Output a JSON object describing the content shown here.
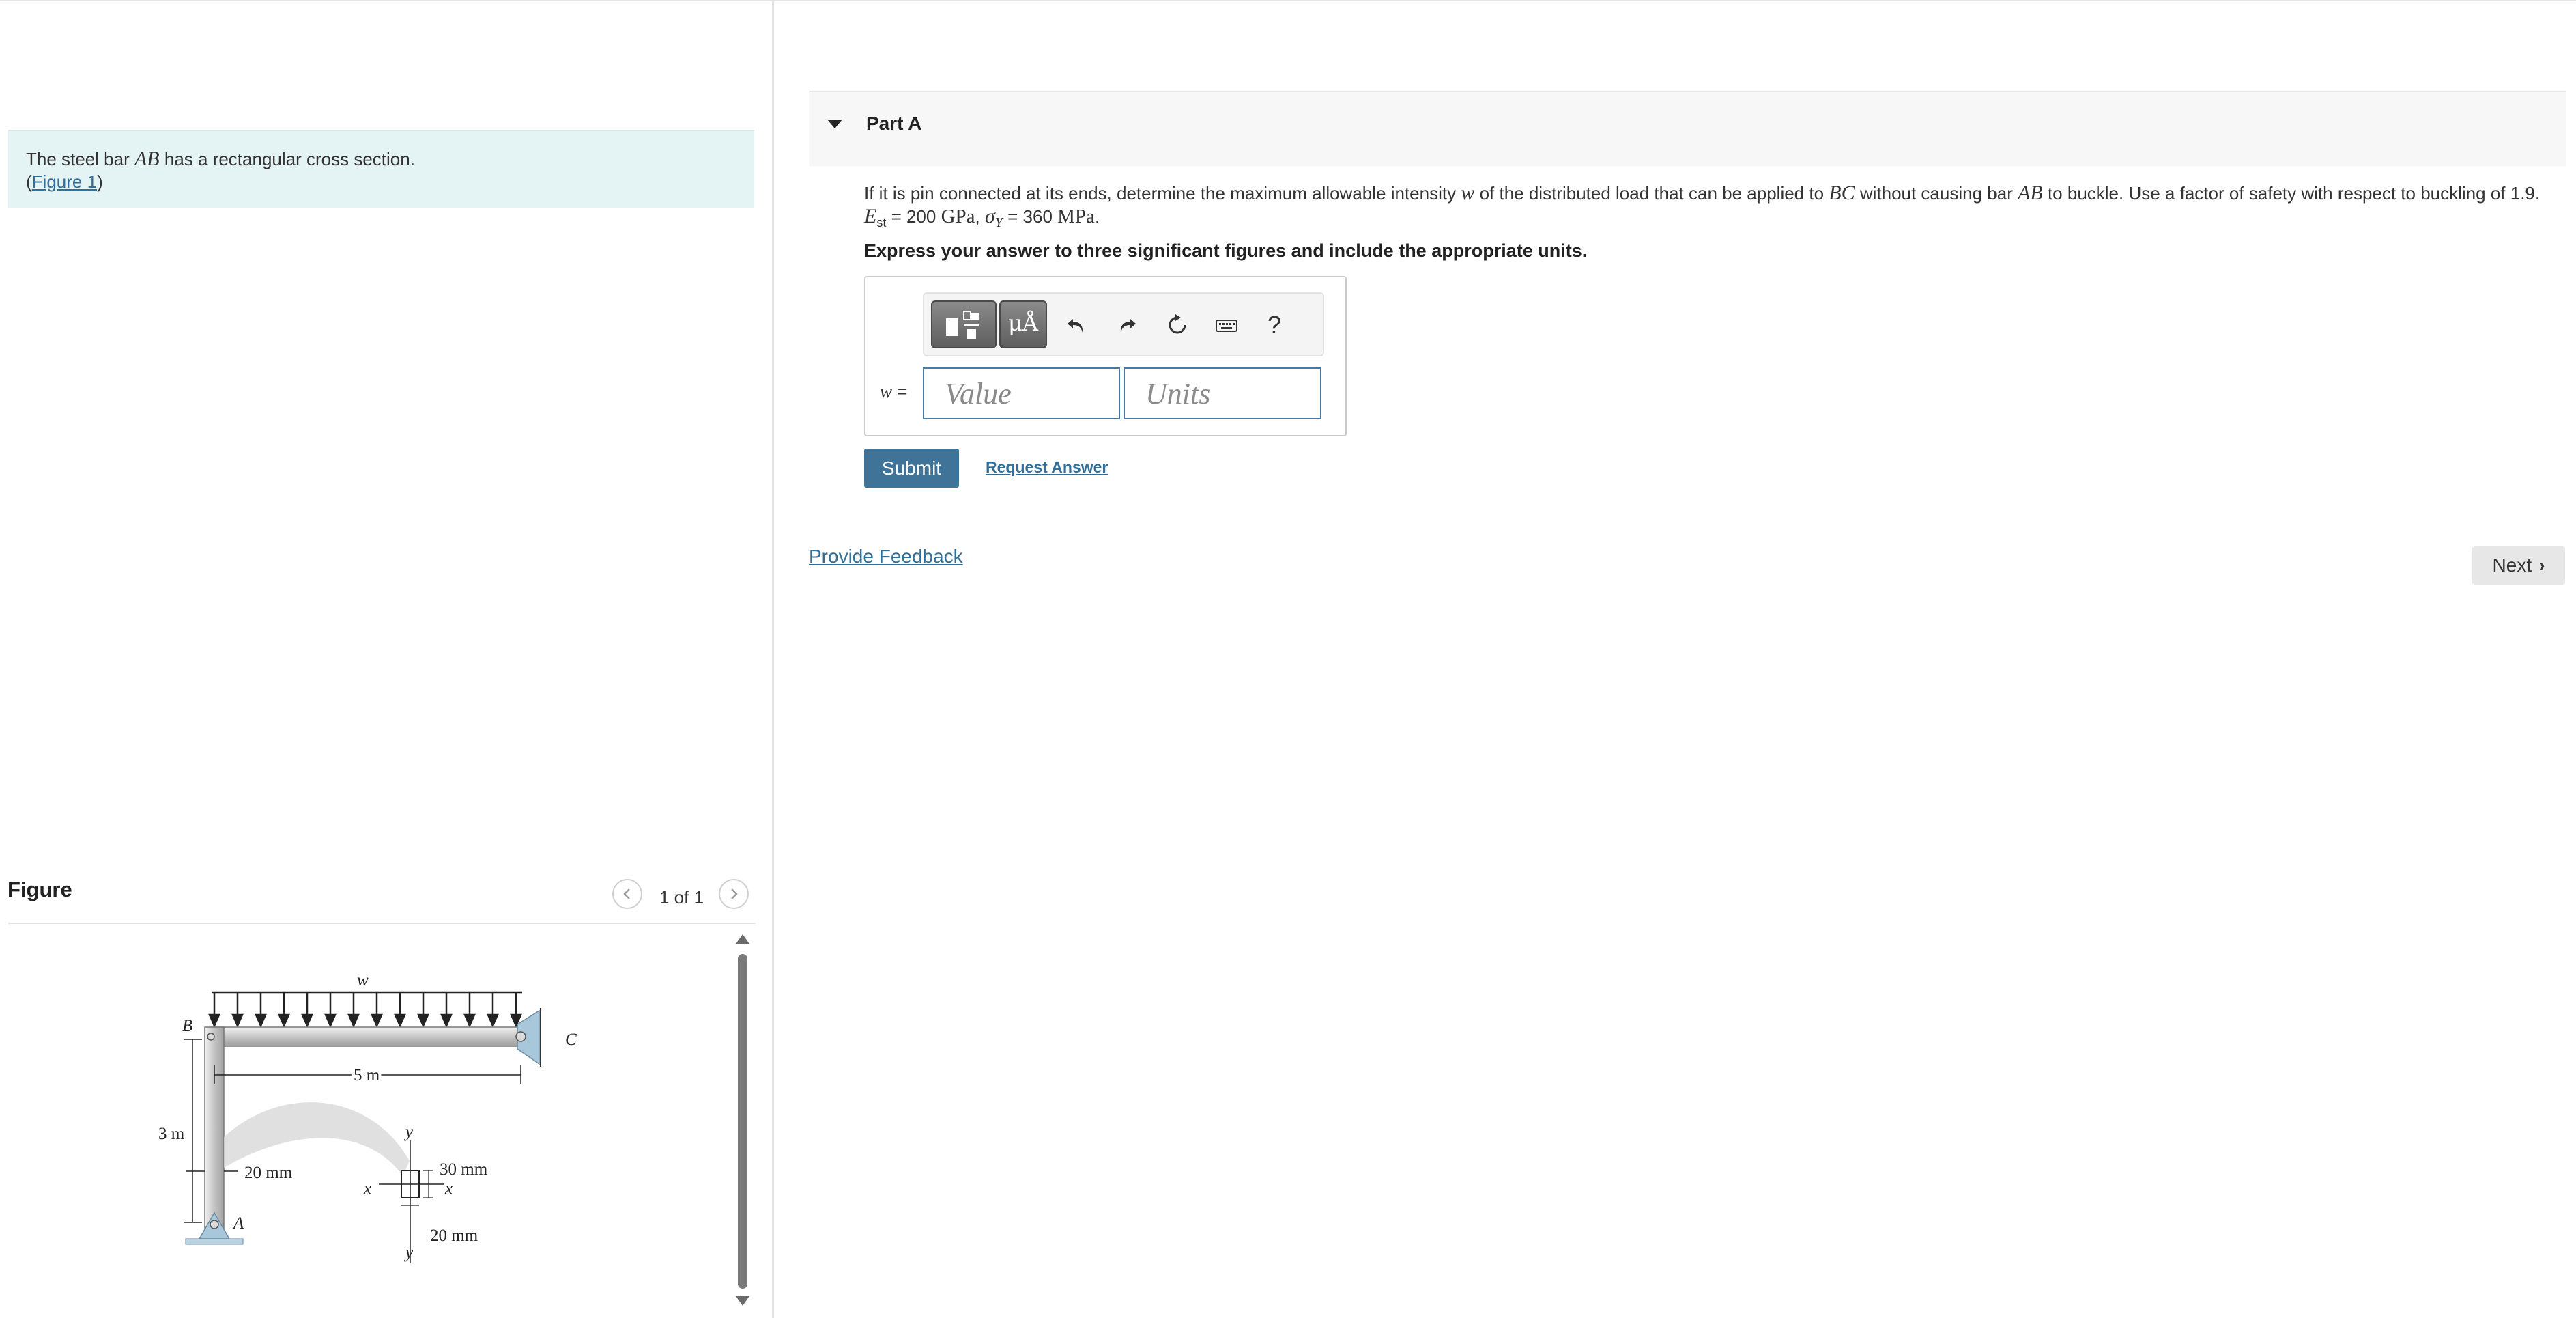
{
  "problem": {
    "intro_prefix": "The steel bar ",
    "intro_bar": "AB",
    "intro_suffix": " has a rectangular cross section.",
    "figure_link": "Figure 1"
  },
  "figure_panel": {
    "title": "Figure",
    "pager": "1 of 1",
    "labels": {
      "B": "B",
      "C": "C",
      "A": "A",
      "w": "w",
      "span": "5 m",
      "height": "3 m",
      "dim_left": "20 mm",
      "dim_depth": "30 mm",
      "dim_width": "20 mm",
      "axis_x": "x",
      "axis_y": "y"
    }
  },
  "part": {
    "title": "Part A",
    "question_1": "If it is pin connected at its ends, determine the maximum allowable intensity ",
    "question_w": "w",
    "question_2": " of the distributed load that can be applied to ",
    "question_bc": "BC",
    "question_3": " without causing bar ",
    "question_ab": "AB",
    "question_4": " to buckle. Use a factor of safety with respect to buckling of 1.9.",
    "e_symbol": "E",
    "e_sub": "st",
    "e_eq": " = 200 ",
    "e_unit": "GPa",
    "sep": ", ",
    "sigma": "σ",
    "sigma_sub": "Y",
    "sigma_eq": " = 360 ",
    "sigma_unit": "MPa",
    "end": ".",
    "instruction": "Express your answer to three significant figures and include the appropriate units."
  },
  "answer": {
    "var_label": "w =",
    "value_placeholder": "Value",
    "units_placeholder": "Units",
    "mu_label": "μÅ",
    "help_label": "?"
  },
  "actions": {
    "submit": "Submit",
    "request": "Request Answer",
    "feedback": "Provide Feedback",
    "next": "Next"
  }
}
